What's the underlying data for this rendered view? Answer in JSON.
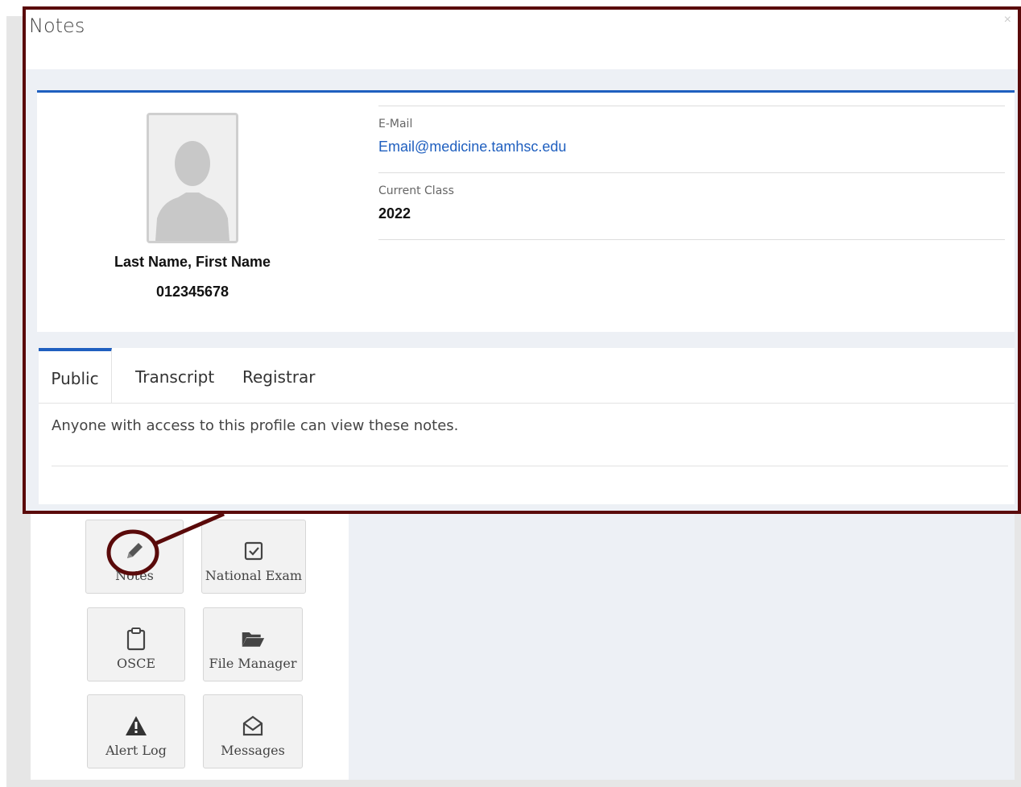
{
  "modal": {
    "title": "Notes",
    "close_glyph": "×"
  },
  "profile": {
    "name": "Last Name, First Name",
    "id": "012345678",
    "email_label": "E-Mail",
    "email": "Email@medicine.tamhsc.edu",
    "class_label": "Current Class",
    "class_value": "2022"
  },
  "notes": {
    "tabs": [
      "Public",
      "Transcript",
      "Registrar"
    ],
    "active_tab": "Public",
    "public_text": "Anyone with access to this profile can view these notes."
  },
  "tiles": [
    {
      "label": "Notes",
      "icon": "pencil-icon"
    },
    {
      "label": "National Exam",
      "icon": "checkbox-icon"
    },
    {
      "label": "OSCE",
      "icon": "clipboard-icon"
    },
    {
      "label": "File Manager",
      "icon": "folder-open-icon"
    },
    {
      "label": "Alert Log",
      "icon": "warning-icon"
    },
    {
      "label": "Messages",
      "icon": "envelope-open-icon"
    }
  ],
  "colors": {
    "accent": "#1f5fbf",
    "callout": "#5a0a0a",
    "body_bg": "#edf0f5"
  }
}
